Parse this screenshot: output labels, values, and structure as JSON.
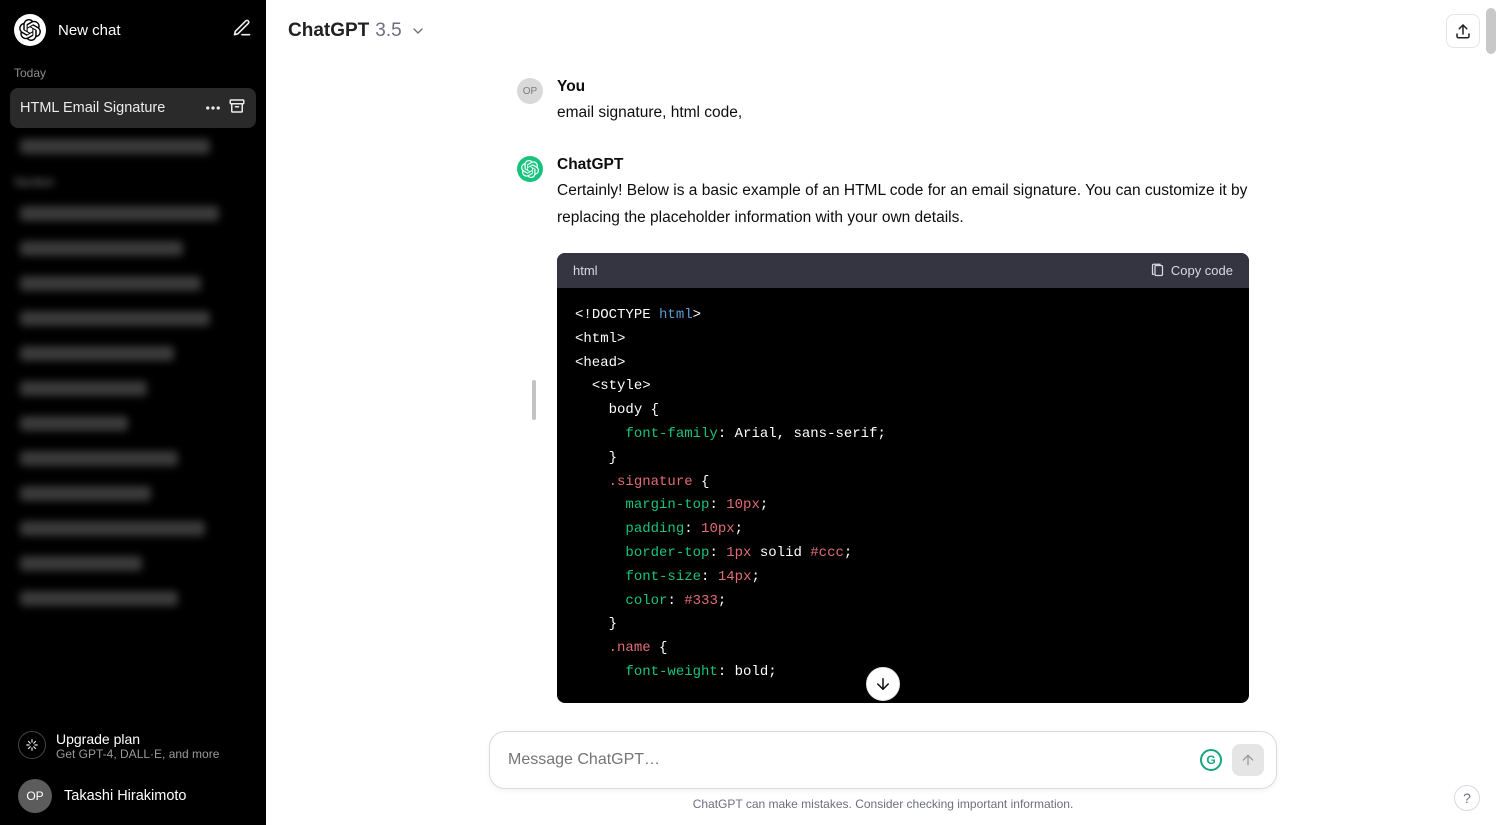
{
  "sidebar": {
    "new_chat_label": "New chat",
    "today_label": "Today",
    "active_chat_title": "HTML Email Signature",
    "upgrade_title": "Upgrade plan",
    "upgrade_sub": "Get GPT-4, DALL·E, and more",
    "avatar_initials": "OP",
    "profile_name": "Takashi Hirakimoto"
  },
  "topbar": {
    "model_name": "ChatGPT",
    "model_version": "3.5"
  },
  "conversation": {
    "user_avatar_initials": "OP",
    "user_author": "You",
    "user_text": "email signature, html code,",
    "assistant_author": "ChatGPT",
    "assistant_text": "Certainly! Below is a basic example of an HTML code for an email signature. You can customize it by replacing the placeholder information with your own details."
  },
  "code": {
    "language": "html",
    "copy_label": "Copy code",
    "lines": [
      [
        [
          "tok-punct",
          "<!"
        ],
        [
          "tok-tag",
          "DOCTYPE "
        ],
        [
          "tok-kw",
          "html"
        ],
        [
          "tok-punct",
          ">"
        ]
      ],
      [
        [
          "tok-punct",
          "<"
        ],
        [
          "tok-tag",
          "html"
        ],
        [
          "tok-punct",
          ">"
        ]
      ],
      [
        [
          "tok-punct",
          "<"
        ],
        [
          "tok-tag",
          "head"
        ],
        [
          "tok-punct",
          ">"
        ]
      ],
      [
        [
          "",
          "  "
        ],
        [
          "tok-punct",
          "<"
        ],
        [
          "tok-tag",
          "style"
        ],
        [
          "tok-punct",
          ">"
        ]
      ],
      [
        [
          "",
          "    "
        ],
        [
          "tok-tag",
          "body "
        ],
        [
          "tok-punct",
          "{"
        ]
      ],
      [
        [
          "",
          "      "
        ],
        [
          "tok-prop",
          "font-family"
        ],
        [
          "tok-punct",
          ": "
        ],
        [
          "tok-tag",
          "Arial, sans-serif;"
        ]
      ],
      [
        [
          "",
          "    "
        ],
        [
          "tok-punct",
          "}"
        ]
      ],
      [
        [
          "",
          "    "
        ],
        [
          "tok-sel",
          ".signature"
        ],
        [
          "tok-punct",
          " {"
        ]
      ],
      [
        [
          "",
          "      "
        ],
        [
          "tok-prop",
          "margin-top"
        ],
        [
          "tok-punct",
          ": "
        ],
        [
          "tok-num",
          "10px"
        ],
        [
          "tok-punct",
          ";"
        ]
      ],
      [
        [
          "",
          "      "
        ],
        [
          "tok-prop",
          "padding"
        ],
        [
          "tok-punct",
          ": "
        ],
        [
          "tok-num",
          "10px"
        ],
        [
          "tok-punct",
          ";"
        ]
      ],
      [
        [
          "",
          "      "
        ],
        [
          "tok-prop",
          "border-top"
        ],
        [
          "tok-punct",
          ": "
        ],
        [
          "tok-num",
          "1px"
        ],
        [
          "tok-tag",
          " solid "
        ],
        [
          "tok-num",
          "#ccc"
        ],
        [
          "tok-punct",
          ";"
        ]
      ],
      [
        [
          "",
          "      "
        ],
        [
          "tok-prop",
          "font-size"
        ],
        [
          "tok-punct",
          ": "
        ],
        [
          "tok-num",
          "14px"
        ],
        [
          "tok-punct",
          ";"
        ]
      ],
      [
        [
          "",
          "      "
        ],
        [
          "tok-prop",
          "color"
        ],
        [
          "tok-punct",
          ": "
        ],
        [
          "tok-num",
          "#333"
        ],
        [
          "tok-punct",
          ";"
        ]
      ],
      [
        [
          "",
          "    "
        ],
        [
          "tok-punct",
          "}"
        ]
      ],
      [
        [
          "",
          "    "
        ],
        [
          "tok-sel",
          ".name"
        ],
        [
          "tok-punct",
          " {"
        ]
      ],
      [
        [
          "",
          "      "
        ],
        [
          "tok-prop",
          "font-weight"
        ],
        [
          "tok-punct",
          ": "
        ],
        [
          "tok-tag",
          "bold;"
        ]
      ]
    ]
  },
  "composer": {
    "placeholder": "Message ChatGPT…"
  },
  "footer": {
    "disclaimer": "ChatGPT can make mistakes. Consider checking important information."
  }
}
